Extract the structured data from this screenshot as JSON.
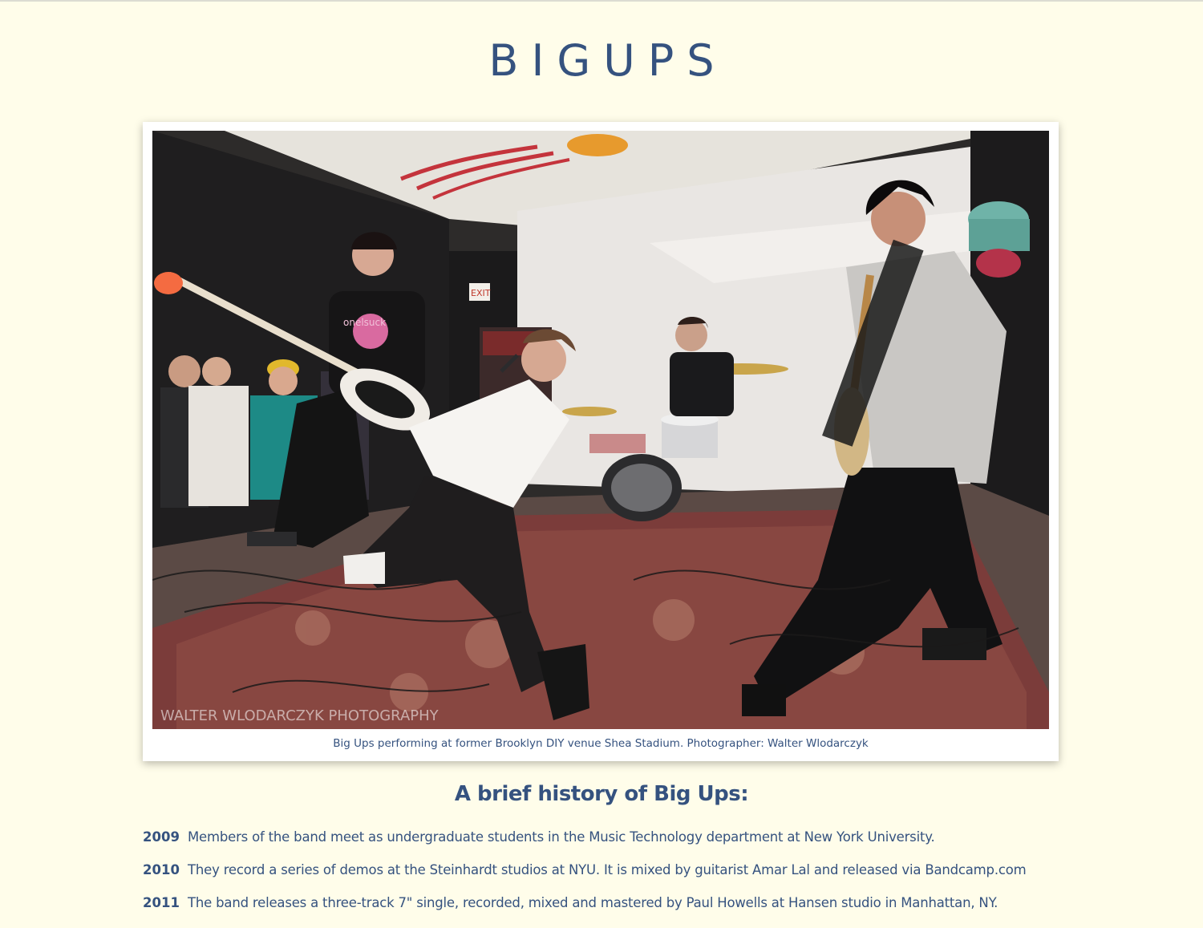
{
  "site": {
    "title": "BIGUPS"
  },
  "photo": {
    "caption": "Big Ups performing at former Brooklyn DIY venue Shea Stadium. Photographer: Walter Wlodarczyk",
    "watermark": "WALTER WLODARCZYK PHOTOGRAPHY",
    "sign": "EXIT",
    "shirt_text": "onelsuck"
  },
  "history": {
    "heading": "A brief history of Big Ups:",
    "items": [
      {
        "year": "2009",
        "text": "Members of the band meet as undergraduate students in the Music Technology department at New York University."
      },
      {
        "year": "2010",
        "text": "They record a series of demos at the Steinhardt studios at NYU. It is mixed by guitarist Amar Lal and released via Bandcamp.com"
      },
      {
        "year": "2011",
        "text": "The band releases a three-track 7\" single, recorded, mixed and mastered by Paul Howells at Hansen studio in Manhattan, NY."
      }
    ]
  },
  "colors": {
    "page_background": "#fffdea",
    "text": "#35527f",
    "card": "#ffffff"
  }
}
